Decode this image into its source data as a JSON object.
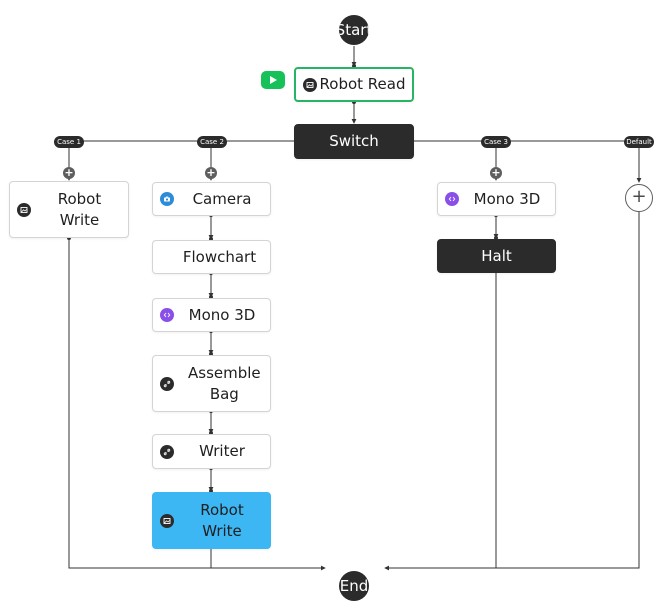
{
  "flow": {
    "start_label": "Start",
    "end_label": "End",
    "robot_read": "Robot Read",
    "switch": "Switch",
    "cases": {
      "case1": "Case 1",
      "case2": "Case 2",
      "case3": "Case 3",
      "default": "Default"
    },
    "case1_nodes": {
      "robot_write": "Robot Write"
    },
    "case2_nodes": {
      "camera": "Camera",
      "flowchart": "Flowchart",
      "mono3d": "Mono 3D",
      "assemble_bag": "Assemble Bag",
      "writer": "Writer",
      "robot_write": "Robot Write"
    },
    "case3_nodes": {
      "mono3d": "Mono 3D",
      "halt": "Halt"
    },
    "add_symbol": "+"
  },
  "colors": {
    "node_dark": "#2b2b2b",
    "selected_border": "#27b464",
    "active_node": "#3db6f4",
    "run_button": "#16c15a",
    "icon_purple": "#8a4fe8",
    "icon_blue": "#2d8cd8"
  }
}
